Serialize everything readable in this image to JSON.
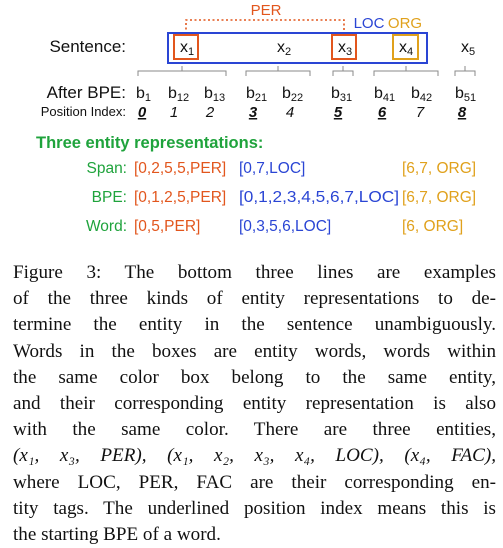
{
  "colors": {
    "per": "#e2561d",
    "loc": "#2a45d4",
    "org": "#e0a11c",
    "green": "#1fa33c",
    "gray": "#8a8a8a"
  },
  "figure": {
    "sentence_label": "Sentence:",
    "after_bpe_label": "After BPE:",
    "position_index_label": "Position Index:",
    "span_labels": {
      "per": "PER",
      "loc": "LOC",
      "org": "ORG"
    },
    "words": [
      {
        "base": "x",
        "sub": "1"
      },
      {
        "base": "x",
        "sub": "2"
      },
      {
        "base": "x",
        "sub": "3"
      },
      {
        "base": "x",
        "sub": "4"
      },
      {
        "base": "x",
        "sub": "5"
      }
    ],
    "bpe_tokens": [
      {
        "base": "b",
        "sub": "1"
      },
      {
        "base": "b",
        "sub": "12"
      },
      {
        "base": "b",
        "sub": "13"
      },
      {
        "base": "b",
        "sub": "21"
      },
      {
        "base": "b",
        "sub": "22"
      },
      {
        "base": "b",
        "sub": "31"
      },
      {
        "base": "b",
        "sub": "41"
      },
      {
        "base": "b",
        "sub": "42"
      },
      {
        "base": "b",
        "sub": "51"
      }
    ],
    "position_indices": [
      "0",
      "1",
      "2",
      "3",
      "4",
      "5",
      "6",
      "7",
      "8"
    ],
    "three_title": "Three entity representations:",
    "representations": [
      {
        "label": "Span:",
        "per": "[0,2,5,5,PER]",
        "loc": "[0,7,LOC]",
        "org": "[6,7, ORG]"
      },
      {
        "label": "BPE:",
        "per": "[0,1,2,5,PER]",
        "loc": "[0,1,2,3,4,5,6,7,LOC]",
        "org": "[6,7, ORG]"
      },
      {
        "label": "Word:",
        "per": "[0,5,PER]",
        "loc": "[0,3,5,6,LOC]",
        "org": "[6, ORG]"
      }
    ]
  },
  "caption": {
    "lines": [
      "Figure 3:  The bottom three lines are examples",
      "of the three kinds of entity representations to de-",
      "termine the entity in the sentence unambiguously.",
      "Words in the boxes are entity words, words within",
      "the same color box belong to the same entity,",
      "and their corresponding entity representation is also",
      "with the same color.   There are three entities,",
      "(x₁, x₃, PER),  (x₁, x₂, x₃, x₄, LOC),  (x₄, FAC),",
      "where LOC, PER, FAC are their corresponding en-",
      "tity tags. The underlined position index means this is",
      "the starting BPE of a word."
    ]
  }
}
